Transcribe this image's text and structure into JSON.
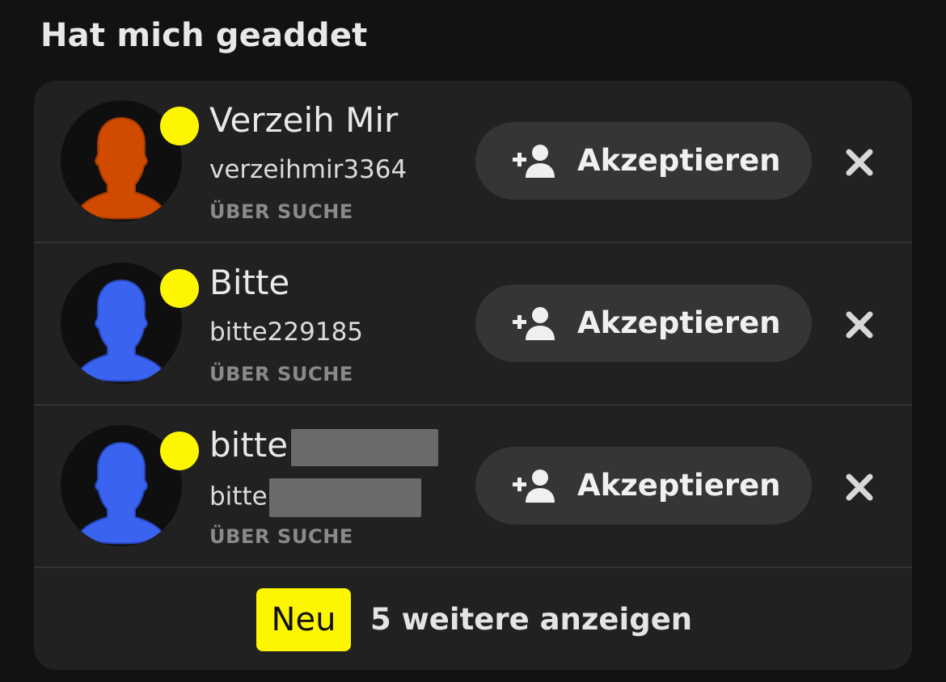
{
  "section": {
    "title": "Hat mich geaddet"
  },
  "requests": [
    {
      "display_name": "Verzeih Mir",
      "username": "verzeihmir3364",
      "source": "ÜBER SUCHE",
      "avatar_color": "#d04a00",
      "redacted": false
    },
    {
      "display_name": "Bitte",
      "username": "bitte229185",
      "source": "ÜBER SUCHE",
      "avatar_color": "#3a64f0",
      "redacted": false
    },
    {
      "display_name": "bitte",
      "username": "bitte",
      "source": "ÜBER SUCHE",
      "avatar_color": "#3a64f0",
      "redacted": true
    }
  ],
  "actions": {
    "accept_label": "Akzeptieren",
    "accept_icon": "add-friend-icon",
    "dismiss_icon": "close-icon"
  },
  "footer": {
    "badge": "Neu",
    "show_more": "5 weitere anzeigen"
  },
  "colors": {
    "background": "#121212",
    "card": "#212121",
    "button": "#353535",
    "story_dot": "#fdf600",
    "badge": "#fdf600"
  }
}
